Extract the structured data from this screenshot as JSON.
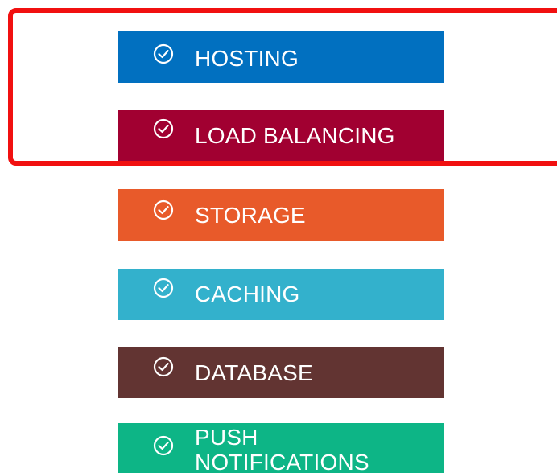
{
  "highlight_color": "#f11010",
  "services": [
    {
      "label": "HOSTING",
      "color": "#0170c0",
      "icon": "check-circle-icon"
    },
    {
      "label": "LOAD BALANCING",
      "color": "#a10031",
      "icon": "check-circle-icon"
    },
    {
      "label": "STORAGE",
      "color": "#e85a2a",
      "icon": "check-circle-icon"
    },
    {
      "label": "CACHING",
      "color": "#33b1cc",
      "icon": "check-circle-icon"
    },
    {
      "label": "DATABASE",
      "color": "#623432",
      "icon": "check-circle-icon"
    },
    {
      "label": "PUSH\nNOTIFICATIONS",
      "color": "#0db586",
      "icon": "check-circle-icon"
    }
  ]
}
